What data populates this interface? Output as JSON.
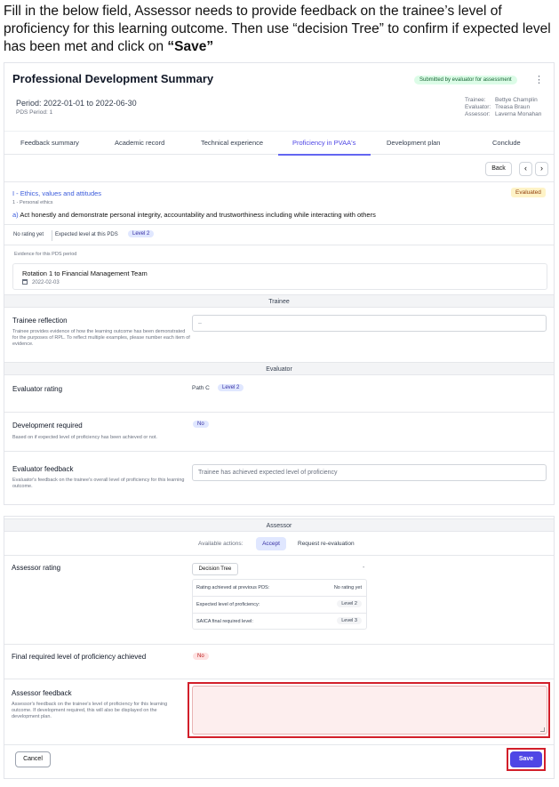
{
  "instruction": {
    "text_before": "Fill in the below field, Assessor needs to provide feedback on the trainee’s level of proficiency for this learning outcome. Then use “decision Tree” to confirm if expected level has been met and click on ",
    "bold": "“Save”"
  },
  "header": {
    "title": "Professional Development Summary",
    "status_badge": "Submitted by evaluator for assessment",
    "menu_glyph": "⋮",
    "period": "Period: 2022-01-01 to 2022-06-30",
    "pds_period": "PDS Period: 1",
    "meta_labels": [
      "Trainee:",
      "Evaluator:",
      "Assessor:"
    ],
    "meta_values": [
      "Bettye Champlin",
      "Treasa Braun",
      "Laverna Monahan"
    ]
  },
  "tabs": [
    "Feedback summary",
    "Academic record",
    "Technical experience",
    "Proficiency in PVAA's",
    "Development plan",
    "Conclude"
  ],
  "nav": {
    "back": "Back",
    "prev": "‹",
    "next": "›"
  },
  "outcome": {
    "section": "I - Ethics, values and attitudes",
    "status": "Evaluated",
    "subsection": "1 - Personal ethics",
    "prefix": "a)",
    "text": "Act honestly and demonstrate personal integrity, accountability and trustworthiness including while interacting with others"
  },
  "rating": {
    "no_rating": "No rating yet",
    "expected_label": "Expected level at this PDS",
    "expected_badge": "Level 2"
  },
  "evidence": {
    "label": "Evidence for this PDS period",
    "title": "Rotation 1 to Financial Management Team",
    "date": "2022-02-03"
  },
  "trainee": {
    "band": "Trainee",
    "reflection_title": "Trainee reflection",
    "reflection_desc": "Trainee provides evidence of how the learning outcome has been demonstrated for the purposes of RPL. To reflect multiple examples, please number each item of evidence.",
    "reflection_value": "–"
  },
  "evaluator": {
    "band": "Evaluator",
    "rating_title": "Evaluator rating",
    "path": "Path C",
    "path_badge": "Level 2",
    "dev_title": "Development required",
    "dev_desc": "Based on if expected level of proficiency has been achieved or not.",
    "dev_badge": "No",
    "fb_title": "Evaluator feedback",
    "fb_desc": "Evaluator's feedback on the trainee's overall level of proficiency for this learning outcome.",
    "fb_value": "Trainee has achieved expected level of proficiency"
  },
  "assessor": {
    "band": "Assessor",
    "actions_label": "Available actions:",
    "accept": "Accept",
    "reeval": "Request re-evaluation",
    "rating_title": "Assessor rating",
    "decision_tree": "Decision Tree",
    "dash": "-",
    "rows": [
      {
        "label": "Rating achieved at previous PDS:",
        "value": "No rating yet"
      },
      {
        "label": "Expected level of proficiency:",
        "value": "Level 2"
      },
      {
        "label": "SAICA final required level:",
        "value": "Level 3"
      }
    ],
    "final_title": "Final required level of proficiency achieved",
    "final_badge": "No",
    "fb_title": "Assessor feedback",
    "fb_desc": "Assessor's feedback on the trainee's level of proficiency for this learning outcome. If development required, this will also be displayed on the development plan.",
    "cancel": "Cancel",
    "save": "Save"
  },
  "colors": {
    "accent": "#4f46e5",
    "highlight": "#d21f2a"
  }
}
